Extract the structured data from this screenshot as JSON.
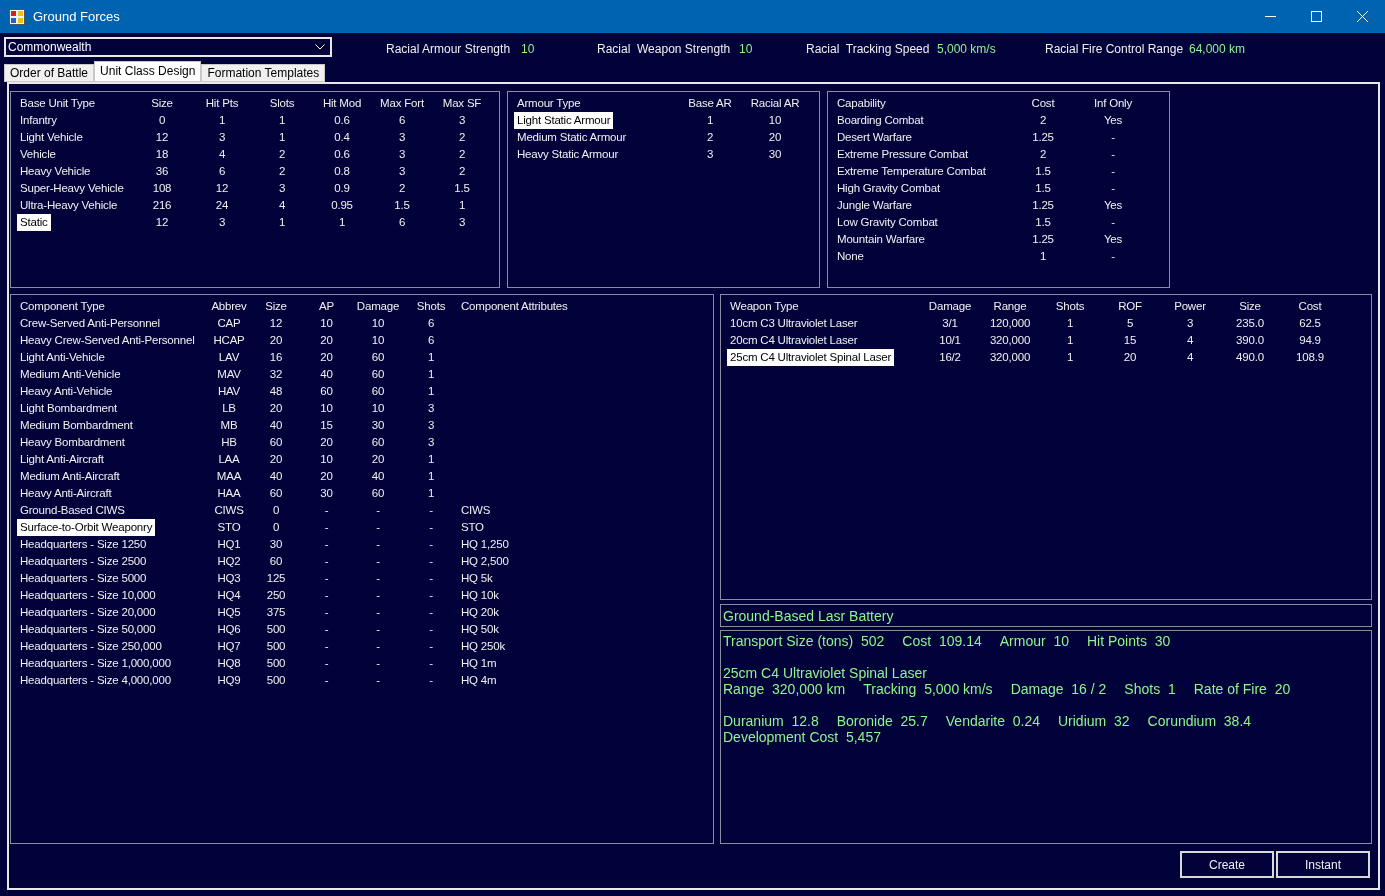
{
  "window": {
    "title": "Ground Forces"
  },
  "faction_select": {
    "value": "Commonwealth"
  },
  "racial_stats": [
    {
      "label": "Racial Armour Strength",
      "value": "10"
    },
    {
      "label": "Racial  Weapon Strength",
      "value": "10"
    },
    {
      "label": "Racial  Tracking Speed",
      "value": "5,000 km/s"
    },
    {
      "label": "Racial Fire Control Range",
      "value": "64,000 km"
    }
  ],
  "tabs": [
    {
      "label": "Order of Battle",
      "selected": false
    },
    {
      "label": "Unit Class Design",
      "selected": true
    },
    {
      "label": "Formation Templates",
      "selected": false
    }
  ],
  "base_unit_types": {
    "columns": [
      "Base Unit Type",
      "Size",
      "Hit Pts",
      "Slots",
      "Hit Mod",
      "Max Fort",
      "Max SF"
    ],
    "rows": [
      {
        "cells": [
          "Infantry",
          "0",
          "1",
          "1",
          "0.6",
          "6",
          "3"
        ],
        "selected": false
      },
      {
        "cells": [
          "Light Vehicle",
          "12",
          "3",
          "1",
          "0.4",
          "3",
          "2"
        ],
        "selected": false
      },
      {
        "cells": [
          "Vehicle",
          "18",
          "4",
          "2",
          "0.6",
          "3",
          "2"
        ],
        "selected": false
      },
      {
        "cells": [
          "Heavy Vehicle",
          "36",
          "6",
          "2",
          "0.8",
          "3",
          "2"
        ],
        "selected": false
      },
      {
        "cells": [
          "Super-Heavy Vehicle",
          "108",
          "12",
          "3",
          "0.9",
          "2",
          "1.5"
        ],
        "selected": false
      },
      {
        "cells": [
          "Ultra-Heavy Vehicle",
          "216",
          "24",
          "4",
          "0.95",
          "1.5",
          "1"
        ],
        "selected": false
      },
      {
        "cells": [
          "Static",
          "12",
          "3",
          "1",
          "1",
          "6",
          "3"
        ],
        "selected": true
      }
    ]
  },
  "armour_types": {
    "columns": [
      "Armour Type",
      "Base AR",
      "Racial AR"
    ],
    "rows": [
      {
        "cells": [
          "Light Static Armour",
          "1",
          "10"
        ],
        "selected": true
      },
      {
        "cells": [
          "Medium Static Armour",
          "2",
          "20"
        ],
        "selected": false
      },
      {
        "cells": [
          "Heavy Static Armour",
          "3",
          "30"
        ],
        "selected": false
      }
    ]
  },
  "capabilities": {
    "columns": [
      "Capability",
      "Cost",
      "Inf Only"
    ],
    "rows": [
      {
        "cells": [
          "Boarding Combat",
          "2",
          "Yes"
        ],
        "selected": false
      },
      {
        "cells": [
          "Desert Warfare",
          "1.25",
          "-"
        ],
        "selected": false
      },
      {
        "cells": [
          "Extreme Pressure Combat",
          "2",
          "-"
        ],
        "selected": false
      },
      {
        "cells": [
          "Extreme Temperature Combat",
          "1.5",
          "-"
        ],
        "selected": false
      },
      {
        "cells": [
          "High Gravity Combat",
          "1.5",
          "-"
        ],
        "selected": false
      },
      {
        "cells": [
          "Jungle Warfare",
          "1.25",
          "Yes"
        ],
        "selected": false
      },
      {
        "cells": [
          "Low Gravity Combat",
          "1.5",
          "-"
        ],
        "selected": false
      },
      {
        "cells": [
          "Mountain Warfare",
          "1.25",
          "Yes"
        ],
        "selected": false
      },
      {
        "cells": [
          "None",
          "1",
          "-"
        ],
        "selected": false
      }
    ]
  },
  "component_types": {
    "columns": [
      "Component Type",
      "Abbrev",
      "Size",
      "AP",
      "Damage",
      "Shots",
      "Component Attributes"
    ],
    "rows": [
      {
        "cells": [
          "Crew-Served Anti-Personnel",
          "CAP",
          "12",
          "10",
          "10",
          "6",
          ""
        ],
        "selected": false
      },
      {
        "cells": [
          "Heavy Crew-Served Anti-Personnel",
          "HCAP",
          "20",
          "20",
          "10",
          "6",
          ""
        ],
        "selected": false
      },
      {
        "cells": [
          "Light Anti-Vehicle",
          "LAV",
          "16",
          "20",
          "60",
          "1",
          ""
        ],
        "selected": false
      },
      {
        "cells": [
          "Medium Anti-Vehicle",
          "MAV",
          "32",
          "40",
          "60",
          "1",
          ""
        ],
        "selected": false
      },
      {
        "cells": [
          "Heavy Anti-Vehicle",
          "HAV",
          "48",
          "60",
          "60",
          "1",
          ""
        ],
        "selected": false
      },
      {
        "cells": [
          "Light Bombardment",
          "LB",
          "20",
          "10",
          "10",
          "3",
          ""
        ],
        "selected": false
      },
      {
        "cells": [
          "Medium Bombardment",
          "MB",
          "40",
          "15",
          "30",
          "3",
          ""
        ],
        "selected": false
      },
      {
        "cells": [
          "Heavy Bombardment",
          "HB",
          "60",
          "20",
          "60",
          "3",
          ""
        ],
        "selected": false
      },
      {
        "cells": [
          "Light Anti-Aircraft",
          "LAA",
          "20",
          "10",
          "20",
          "1",
          ""
        ],
        "selected": false
      },
      {
        "cells": [
          "Medium Anti-Aircraft",
          "MAA",
          "40",
          "20",
          "40",
          "1",
          ""
        ],
        "selected": false
      },
      {
        "cells": [
          "Heavy Anti-Aircraft",
          "HAA",
          "60",
          "30",
          "60",
          "1",
          ""
        ],
        "selected": false
      },
      {
        "cells": [
          "Ground-Based CIWS",
          "CIWS",
          "0",
          "-",
          "-",
          "-",
          "CIWS"
        ],
        "selected": false
      },
      {
        "cells": [
          "Surface-to-Orbit Weaponry",
          "STO",
          "0",
          "-",
          "-",
          "-",
          "STO"
        ],
        "selected": true
      },
      {
        "cells": [
          "Headquarters - Size 1250",
          "HQ1",
          "30",
          "-",
          "-",
          "-",
          "HQ 1,250"
        ],
        "selected": false
      },
      {
        "cells": [
          "Headquarters - Size 2500",
          "HQ2",
          "60",
          "-",
          "-",
          "-",
          "HQ 2,500"
        ],
        "selected": false
      },
      {
        "cells": [
          "Headquarters - Size 5000",
          "HQ3",
          "125",
          "-",
          "-",
          "-",
          "HQ 5k"
        ],
        "selected": false
      },
      {
        "cells": [
          "Headquarters - Size 10,000",
          "HQ4",
          "250",
          "-",
          "-",
          "-",
          "HQ 10k"
        ],
        "selected": false
      },
      {
        "cells": [
          "Headquarters - Size 20,000",
          "HQ5",
          "375",
          "-",
          "-",
          "-",
          "HQ 20k"
        ],
        "selected": false
      },
      {
        "cells": [
          "Headquarters - Size 50,000",
          "HQ6",
          "500",
          "-",
          "-",
          "-",
          "HQ 50k"
        ],
        "selected": false
      },
      {
        "cells": [
          "Headquarters - Size 250,000",
          "HQ7",
          "500",
          "-",
          "-",
          "-",
          "HQ 250k"
        ],
        "selected": false
      },
      {
        "cells": [
          "Headquarters - Size 1,000,000",
          "HQ8",
          "500",
          "-",
          "-",
          "-",
          "HQ 1m"
        ],
        "selected": false
      },
      {
        "cells": [
          "Headquarters - Size 4,000,000",
          "HQ9",
          "500",
          "-",
          "-",
          "-",
          "HQ 4m"
        ],
        "selected": false
      }
    ]
  },
  "weapon_types": {
    "columns": [
      "Weapon Type",
      "Damage",
      "Range",
      "Shots",
      "ROF",
      "Power",
      "Size",
      "Cost"
    ],
    "rows": [
      {
        "cells": [
          "10cm C3 Ultraviolet Laser",
          "3/1",
          "120,000",
          "1",
          "5",
          "3",
          "235.0",
          "62.5"
        ],
        "selected": false
      },
      {
        "cells": [
          "20cm C4 Ultraviolet Laser",
          "10/1",
          "320,000",
          "1",
          "15",
          "4",
          "390.0",
          "94.9"
        ],
        "selected": false
      },
      {
        "cells": [
          "25cm C4 Ultraviolet Spinal Laser",
          "16/2",
          "320,000",
          "1",
          "20",
          "4",
          "490.0",
          "108.9"
        ],
        "selected": true
      }
    ]
  },
  "design_name": {
    "value": "Ground-Based Lasr Battery"
  },
  "design_summary": {
    "groups": [
      [
        [
          "Transport Size (tons)  502",
          "Cost  109.14",
          "Armour  10",
          "Hit Points  30"
        ]
      ],
      [
        [
          "25cm C4 Ultraviolet Spinal Laser"
        ],
        [
          "Range  320,000 km",
          "Tracking  5,000 km/s",
          "Damage  16 / 2",
          "Shots  1",
          "Rate of Fire  20"
        ]
      ],
      [
        [
          "Duranium  12.8",
          "Boronide  25.7",
          "Vendarite  0.24",
          "Uridium  32",
          "Corundium  38.4"
        ],
        [
          "Development Cost  5,457"
        ]
      ]
    ]
  },
  "buttons": [
    "Create",
    "Instant"
  ]
}
